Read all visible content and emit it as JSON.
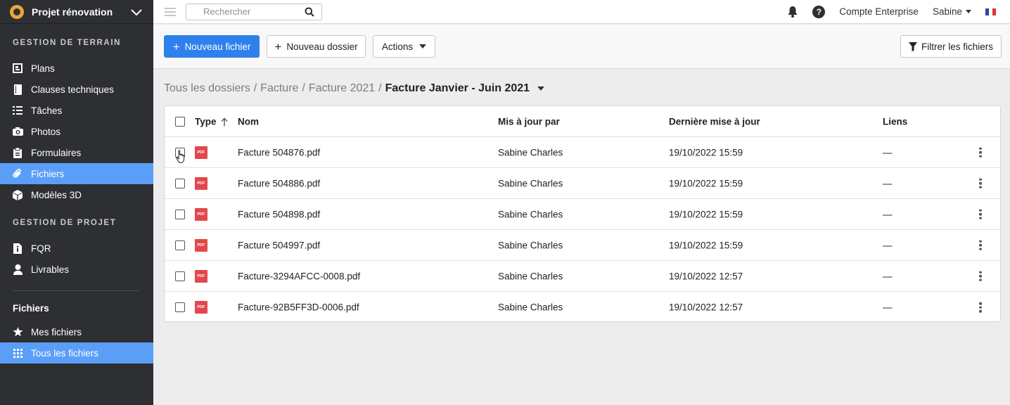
{
  "project": {
    "name": "Projet rénovation"
  },
  "sidebar": {
    "section1_title": "GESTION DE TERRAIN",
    "section1_items": [
      {
        "label": "Plans",
        "icon": "plans-icon"
      },
      {
        "label": "Clauses techniques",
        "icon": "book-icon"
      },
      {
        "label": "Tâches",
        "icon": "list-icon"
      },
      {
        "label": "Photos",
        "icon": "camera-icon"
      },
      {
        "label": "Formulaires",
        "icon": "clipboard-icon"
      },
      {
        "label": "Fichiers",
        "icon": "paperclip-icon",
        "active": true
      },
      {
        "label": "Modèles 3D",
        "icon": "cube-icon"
      }
    ],
    "section2_title": "GESTION DE PROJET",
    "section2_items": [
      {
        "label": "FQR",
        "icon": "info-doc-icon"
      },
      {
        "label": "Livrables",
        "icon": "person-icon"
      }
    ],
    "files_title": "Fichiers",
    "files_items": [
      {
        "label": "Mes fichiers",
        "icon": "star-icon"
      },
      {
        "label": "Tous les fichiers",
        "icon": "grid-icon",
        "active": true
      }
    ]
  },
  "topbar": {
    "search_placeholder": "Rechercher",
    "account": "Compte Enterprise",
    "user": "Sabine"
  },
  "toolbar": {
    "new_file": "Nouveau fichier",
    "new_folder": "Nouveau dossier",
    "actions": "Actions",
    "filter": "Filtrer les fichiers"
  },
  "breadcrumb": {
    "items": [
      "Tous les dossiers",
      "Facture",
      "Facture 2021"
    ],
    "current": "Facture Janvier - Juin 2021"
  },
  "table": {
    "headers": {
      "type": "Type",
      "name": "Nom",
      "updated_by": "Mis à jour par",
      "updated_at": "Dernière mise à jour",
      "links": "Liens"
    },
    "file_badge": "PDF",
    "rows": [
      {
        "name": "Facture 504876.pdf",
        "by": "Sabine Charles",
        "date": "19/10/2022 15:59",
        "links": "—"
      },
      {
        "name": "Facture 504886.pdf",
        "by": "Sabine Charles",
        "date": "19/10/2022 15:59",
        "links": "—"
      },
      {
        "name": "Facture 504898.pdf",
        "by": "Sabine Charles",
        "date": "19/10/2022 15:59",
        "links": "—"
      },
      {
        "name": "Facture 504997.pdf",
        "by": "Sabine Charles",
        "date": "19/10/2022 15:59",
        "links": "—"
      },
      {
        "name": "Facture-3294AFCC-0008.pdf",
        "by": "Sabine Charles",
        "date": "19/10/2022 12:57",
        "links": "—"
      },
      {
        "name": "Facture-92B5FF3D-0006.pdf",
        "by": "Sabine Charles",
        "date": "19/10/2022 12:57",
        "links": "—"
      }
    ]
  },
  "colors": {
    "accent": "#2e80ec",
    "sidebar_bg": "#2d2f32",
    "active_nav": "#5b9ef7",
    "pdf": "#e4474b"
  }
}
